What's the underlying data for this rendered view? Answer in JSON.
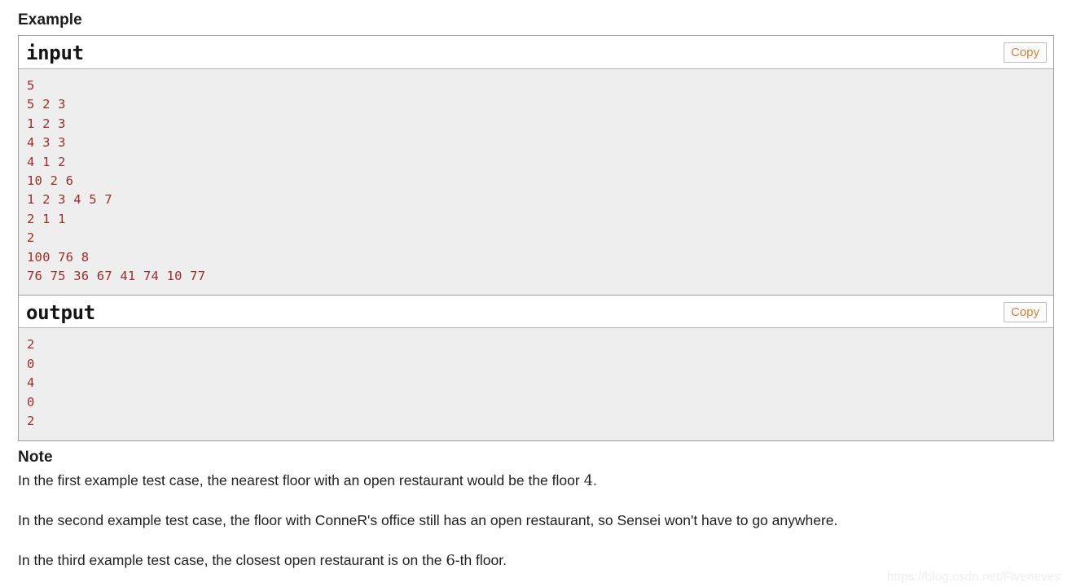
{
  "example": {
    "heading": "Example",
    "blocks": [
      {
        "title": "input",
        "copy_label": "Copy",
        "content": "5\n5 2 3\n1 2 3\n4 3 3\n4 1 2\n10 2 6\n1 2 3 4 5 7\n2 1 1\n2\n100 76 8\n76 75 36 67 41 74 10 77"
      },
      {
        "title": "output",
        "copy_label": "Copy",
        "content": "2\n0\n4\n0\n2"
      }
    ]
  },
  "note": {
    "heading": "Note",
    "paragraphs": [
      {
        "prefix": "In the first example test case, the nearest floor with an open restaurant would be the floor ",
        "math": "4",
        "suffix": "."
      },
      {
        "prefix": "In the second example test case, the floor with ConneR's office still has an open restaurant, so Sensei won't have to go anywhere.",
        "math": "",
        "suffix": ""
      },
      {
        "prefix": "In the third example test case, the closest open restaurant is on the ",
        "math": "6",
        "suffix": "-th floor."
      }
    ]
  },
  "watermark": {
    "text": "https://blog.csdn.net/Fiveneves"
  },
  "colors": {
    "sample_text": "#9c2d2d",
    "sample_bg": "#eeeeee",
    "copy_text": "#d08134",
    "border": "#9e9e9e"
  }
}
